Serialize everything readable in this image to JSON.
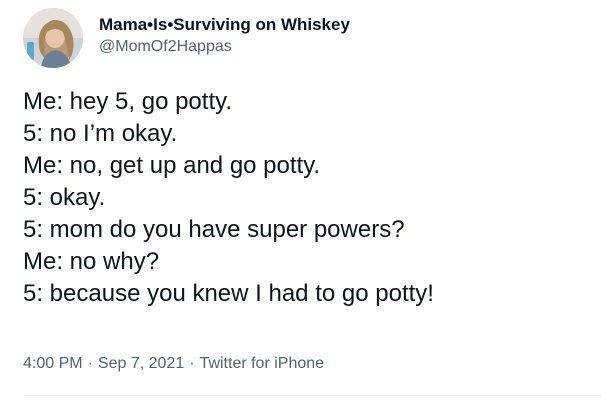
{
  "author": {
    "display_name": "Mama•Is•Surviving on Whiskey",
    "handle": "@MomOf2Happas",
    "avatar_icon": "profile-photo-icon"
  },
  "tweet": {
    "lines": [
      "Me: hey 5, go potty.",
      "5: no I’m okay.",
      "Me: no, get up and go potty.",
      "5: okay.",
      "5: mom do you have super powers?",
      "Me: no why?",
      "5: because you knew I had to go potty!"
    ]
  },
  "meta": {
    "time": "4:00 PM",
    "separator": "·",
    "date": "Sep 7, 2021",
    "source": "Twitter for iPhone"
  },
  "colors": {
    "text_primary": "#0f1419",
    "text_secondary": "#536471",
    "divider": "#eff3f4"
  }
}
